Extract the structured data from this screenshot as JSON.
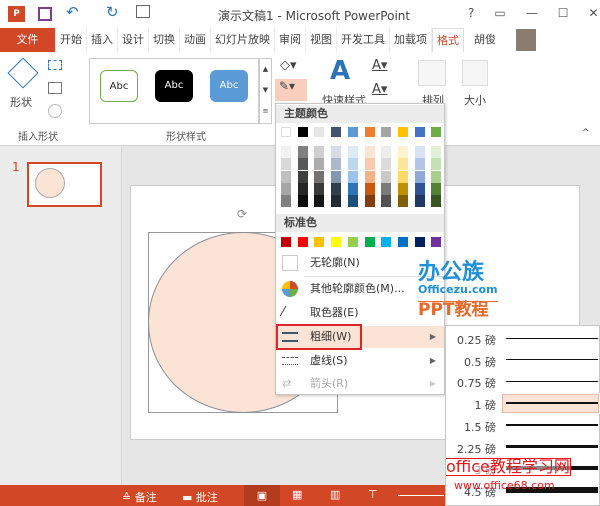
{
  "title": "演示文稿1 - Microsoft PowerPoint",
  "window_buttons": [
    "?",
    "▭",
    "—",
    "☐",
    "✕"
  ],
  "tabs": [
    "文件",
    "开始",
    "插入",
    "设计",
    "切换",
    "动画",
    "幻灯片放映",
    "审阅",
    "视图",
    "开发工具",
    "加载项",
    "格式"
  ],
  "user": "胡俊",
  "ribbon": {
    "shapes_label": "形状",
    "insert_shapes_group": "插入形状",
    "abc": [
      "Abc",
      "Abc",
      "Abc"
    ],
    "shape_styles_group": "形状样式",
    "quick_styles": "快速样式",
    "arrange": "排列",
    "size": "大小"
  },
  "slide_number": "1",
  "menu": {
    "theme_colors": "主题颜色",
    "standard_colors": "标准色",
    "no_outline": "无轮廓(N)",
    "more_colors": "其他轮廓颜色(M)...",
    "eyedropper": "取色器(E)",
    "weight": "粗细(W)",
    "dashes": "虚线(S)",
    "arrows": "箭头(R)"
  },
  "theme_row": [
    "#ffffff",
    "#000000",
    "#e7e6e6",
    "#44546a",
    "#5b9bd5",
    "#ed7d31",
    "#a5a5a5",
    "#ffc000",
    "#4472c4",
    "#70ad47"
  ],
  "theme_shades": [
    [
      "#f2f2f2",
      "#d9d9d9",
      "#bfbfbf",
      "#a6a6a6",
      "#808080"
    ],
    [
      "#7f7f7f",
      "#595959",
      "#3f3f3f",
      "#262626",
      "#0d0d0d"
    ],
    [
      "#d0cece",
      "#aeabab",
      "#757171",
      "#3a3838",
      "#171616"
    ],
    [
      "#d6dce4",
      "#adb9ca",
      "#8496b0",
      "#333f4f",
      "#222a35"
    ],
    [
      "#deebf6",
      "#bdd7ee",
      "#9dc3e6",
      "#2e75b5",
      "#1e4e79"
    ],
    [
      "#fbe5d5",
      "#f7cbac",
      "#f4b183",
      "#c55a11",
      "#843c0b"
    ],
    [
      "#ededed",
      "#dbdbdb",
      "#c9c9c9",
      "#7b7b7b",
      "#525252"
    ],
    [
      "#fff2cc",
      "#fee599",
      "#ffd965",
      "#bf9000",
      "#7f6000"
    ],
    [
      "#d9e2f3",
      "#b4c6e7",
      "#8eaadb",
      "#2f5496",
      "#1f3864"
    ],
    [
      "#e2efd9",
      "#c5e0b3",
      "#a8d08d",
      "#538135",
      "#375623"
    ]
  ],
  "standard_row": [
    "#c00000",
    "#ff0000",
    "#ffc000",
    "#ffff00",
    "#92d050",
    "#00b050",
    "#00b0f0",
    "#0070c0",
    "#002060",
    "#7030a0"
  ],
  "weights": [
    {
      "label": "0.25 磅",
      "w": 0.25
    },
    {
      "label": "0.5 磅",
      "w": 0.5
    },
    {
      "label": "0.75 磅",
      "w": 0.75
    },
    {
      "label": "1 磅",
      "w": 1
    },
    {
      "label": "1.5 磅",
      "w": 1.5
    },
    {
      "label": "2.25 磅",
      "w": 2.25
    },
    {
      "label": "3 磅",
      "w": 3
    },
    {
      "label": "4.5 磅",
      "w": 4.5
    }
  ],
  "selected_weight": "1 磅",
  "status": {
    "notes": "备注",
    "comments": "批注"
  },
  "watermarks": {
    "a": "办公族",
    "b": "Officezu.com",
    "c": "PPT教程",
    "d": "office教程学习网",
    "e": "www.office68.com"
  },
  "accent": "#d24726"
}
